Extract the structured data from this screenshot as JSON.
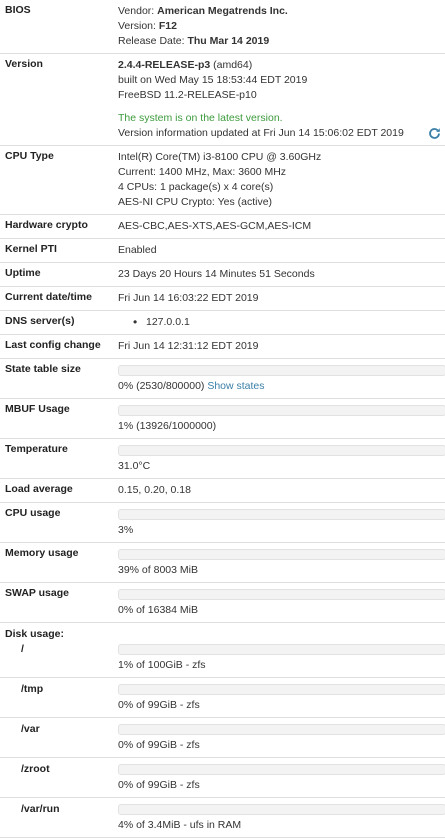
{
  "colors": {
    "bar_fill": "#b2313a",
    "ok_text": "#3c9b3c",
    "link": "#3a7fa7"
  },
  "bios": {
    "label": "BIOS",
    "vendor_prefix": "Vendor: ",
    "vendor": "American Megatrends Inc.",
    "version_prefix": "Version: ",
    "version": "F12",
    "release_prefix": "Release Date: ",
    "release_date": "Thu Mar 14 2019"
  },
  "version": {
    "label": "Version",
    "release": "2.4.4-RELEASE-p3",
    "arch": " (amd64)",
    "built": "built on Wed May 15 18:53:44 EDT 2019",
    "freebsd": "FreeBSD 11.2-RELEASE-p10",
    "status": "The system is on the latest version.",
    "updated": "Version information updated at Fri Jun 14 15:06:02 EDT 2019",
    "refresh_icon": "refresh-icon"
  },
  "cpu_type": {
    "label": "CPU Type",
    "lines": [
      "Intel(R) Core(TM) i3-8100 CPU @ 3.60GHz",
      "Current: 1400 MHz, Max: 3600 MHz",
      "4 CPUs: 1 package(s) x 4 core(s)",
      "AES-NI CPU Crypto: Yes (active)"
    ]
  },
  "hardware_crypto": {
    "label": "Hardware crypto",
    "value": "AES-CBC,AES-XTS,AES-GCM,AES-ICM"
  },
  "kernel_pti": {
    "label": "Kernel PTI",
    "value": "Enabled"
  },
  "uptime": {
    "label": "Uptime",
    "value": "23 Days 20 Hours 14 Minutes 51 Seconds"
  },
  "current_date": {
    "label": "Current date/time",
    "value": "Fri Jun 14 16:03:22 EDT 2019"
  },
  "dns": {
    "label": "DNS server(s)",
    "servers": [
      "127.0.0.1"
    ]
  },
  "last_config": {
    "label": "Last config change",
    "value": "Fri Jun 14 12:31:12 EDT 2019"
  },
  "state_table": {
    "label": "State table size",
    "percent": 0,
    "text": "0% (2530/800000)",
    "link": "Show states"
  },
  "mbuf": {
    "label": "MBUF Usage",
    "percent": 1,
    "text": "1% (13926/1000000)"
  },
  "temperature": {
    "label": "Temperature",
    "percent": 31,
    "text": "31.0°C"
  },
  "load_average": {
    "label": "Load average",
    "value": "0.15, 0.20, 0.18"
  },
  "cpu_usage": {
    "label": "CPU usage",
    "percent": 3,
    "text": "3%"
  },
  "memory_usage": {
    "label": "Memory usage",
    "percent": 39,
    "text": "39% of 8003 MiB"
  },
  "swap_usage": {
    "label": "SWAP usage",
    "percent": 0,
    "text": "0% of 16384 MiB"
  },
  "disk_usage": {
    "label": "Disk usage:",
    "disks": [
      {
        "mount": "/",
        "percent": 1,
        "text": "1% of 100GiB - zfs"
      },
      {
        "mount": "/tmp",
        "percent": 0,
        "text": "0% of 99GiB - zfs"
      },
      {
        "mount": "/var",
        "percent": 0,
        "text": "0% of 99GiB - zfs"
      },
      {
        "mount": "/zroot",
        "percent": 0,
        "text": "0% of 99GiB - zfs"
      },
      {
        "mount": "/var/run",
        "percent": 4,
        "text": "4% of 3.4MiB - ufs in RAM"
      }
    ]
  }
}
